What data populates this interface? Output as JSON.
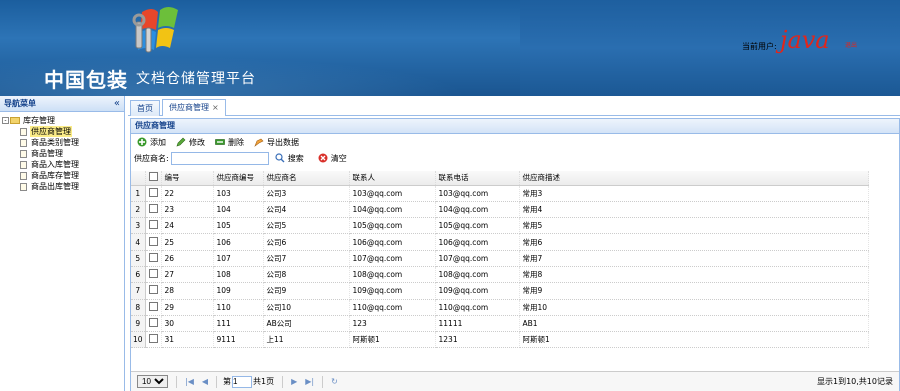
{
  "header": {
    "brand": "中国包装",
    "subtitle": "文档仓储管理平台",
    "user_label": "当前用户:",
    "user_name": "java",
    "user_suffix": "退出"
  },
  "sidebar": {
    "title": "导航菜单",
    "collapse_icon": "«",
    "root": "库存管理",
    "items": [
      "供应商管理",
      "商品类别管理",
      "商品管理",
      "商品入库管理",
      "商品库存管理",
      "商品出库管理"
    ]
  },
  "tabs": [
    {
      "label": "首页"
    },
    {
      "label": "供应商管理",
      "close": "×"
    }
  ],
  "panel": {
    "title": "供应商管理"
  },
  "toolbar": {
    "add": "添加",
    "edit": "修改",
    "delete": "删除",
    "export": "导出数据"
  },
  "search": {
    "label": "供应商名:",
    "value": "",
    "search_btn": "搜索",
    "clear_btn": "清空"
  },
  "grid": {
    "columns": [
      "编号",
      "供应商编号",
      "供应商名",
      "联系人",
      "联系电话",
      "供应商描述"
    ],
    "rows": [
      [
        "1",
        "22",
        "103",
        "公司3",
        "103@qq.com",
        "103@qq.com",
        "常用3"
      ],
      [
        "2",
        "23",
        "104",
        "公司4",
        "104@qq.com",
        "104@qq.com",
        "常用4"
      ],
      [
        "3",
        "24",
        "105",
        "公司5",
        "105@qq.com",
        "105@qq.com",
        "常用5"
      ],
      [
        "4",
        "25",
        "106",
        "公司6",
        "106@qq.com",
        "106@qq.com",
        "常用6"
      ],
      [
        "5",
        "26",
        "107",
        "公司7",
        "107@qq.com",
        "107@qq.com",
        "常用7"
      ],
      [
        "6",
        "27",
        "108",
        "公司8",
        "108@qq.com",
        "108@qq.com",
        "常用8"
      ],
      [
        "7",
        "28",
        "109",
        "公司9",
        "109@qq.com",
        "109@qq.com",
        "常用9"
      ],
      [
        "8",
        "29",
        "110",
        "公司10",
        "110@qq.com",
        "110@qq.com",
        "常用10"
      ],
      [
        "9",
        "30",
        "111",
        "AB公司",
        "123",
        "11111",
        "AB1"
      ],
      [
        "10",
        "31",
        "9111",
        "上11",
        "阿斯顿1",
        "1231",
        "阿斯顿1"
      ]
    ]
  },
  "pager": {
    "page_size": "10",
    "page_prefix": "第",
    "page_value": "1",
    "page_suffix": "共1页",
    "info": "显示1到10,共10记录"
  },
  "colors": {
    "header_bg": "#1a5a9a",
    "accent": "#15428b",
    "border": "#99bbe8",
    "user_red": "#e0261c"
  }
}
